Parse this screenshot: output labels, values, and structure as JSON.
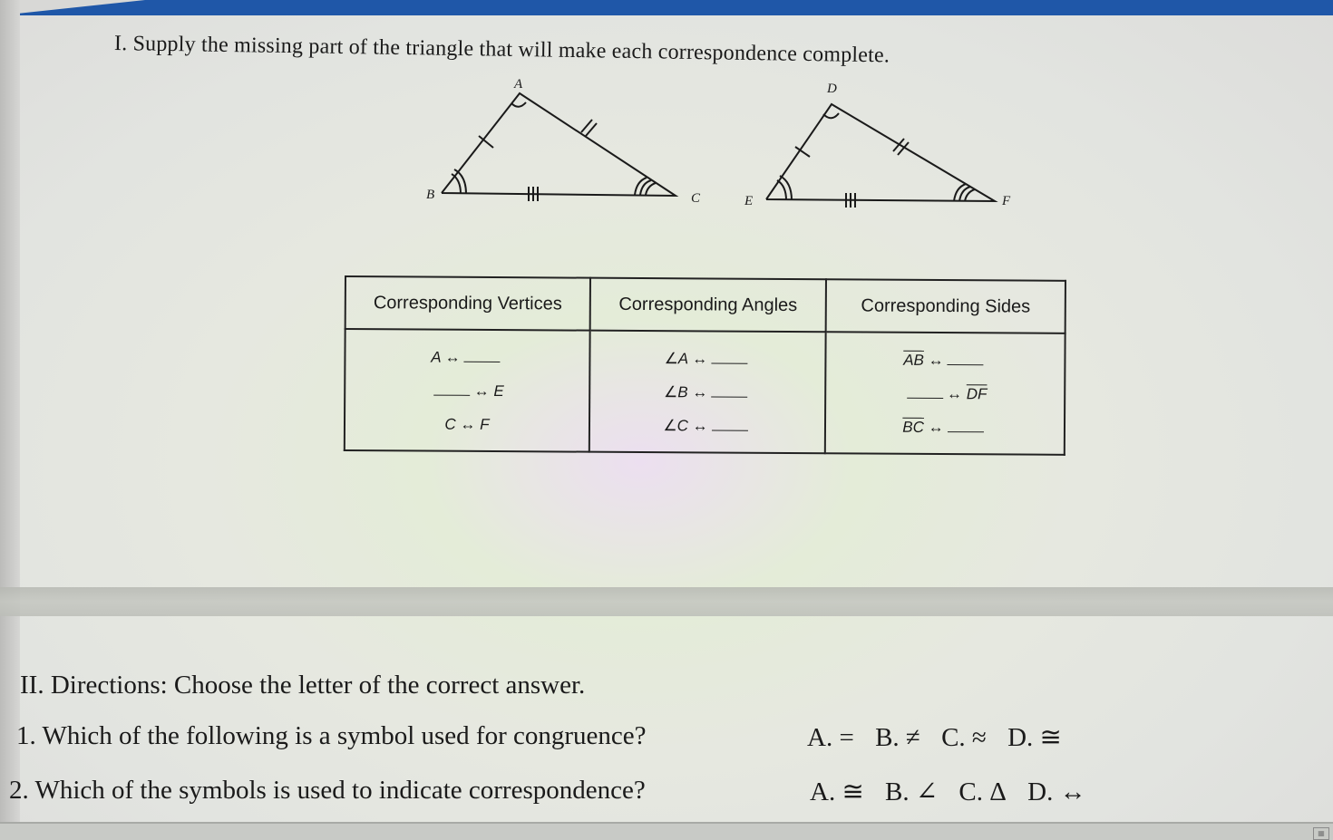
{
  "section1": {
    "title": "I. Supply the missing part of the triangle that will make each correspondence complete.",
    "triangle1": {
      "vertices": {
        "top": "A",
        "left": "B",
        "right": "C"
      }
    },
    "triangle2": {
      "vertices": {
        "top": "D",
        "left": "E",
        "right": "F"
      }
    },
    "table": {
      "headers": [
        "Corresponding Vertices",
        "Corresponding Angles",
        "Corresponding Sides"
      ],
      "vertices": [
        {
          "left": "A ↔",
          "right": ""
        },
        {
          "left": "",
          "right": "↔ E"
        },
        {
          "left": "C ↔ F",
          "right": ""
        }
      ],
      "angles": [
        "∠A ↔",
        "∠B ↔",
        "∠C ↔"
      ],
      "sides": [
        {
          "seg": "AB",
          "arrow": "↔",
          "blank_after": true
        },
        {
          "seg": "DF",
          "arrow": "↔",
          "blank_before": true
        },
        {
          "seg": "BC",
          "arrow": "↔",
          "blank_after": true
        }
      ]
    }
  },
  "section2": {
    "title": "II. Directions: Choose the letter of the correct answer.",
    "questions": [
      {
        "text": "1. Which of the following is a symbol used for congruence?",
        "options": [
          "A. =",
          "B. ≠",
          "C. ≈",
          "D. ≅"
        ]
      },
      {
        "text": "2. Which of the symbols is used to indicate correspondence?",
        "options": [
          "A. ≅",
          "B. ∠",
          "C. Δ",
          "D. ↔"
        ]
      }
    ]
  },
  "colors": {
    "topbar": "#1f57a8"
  }
}
